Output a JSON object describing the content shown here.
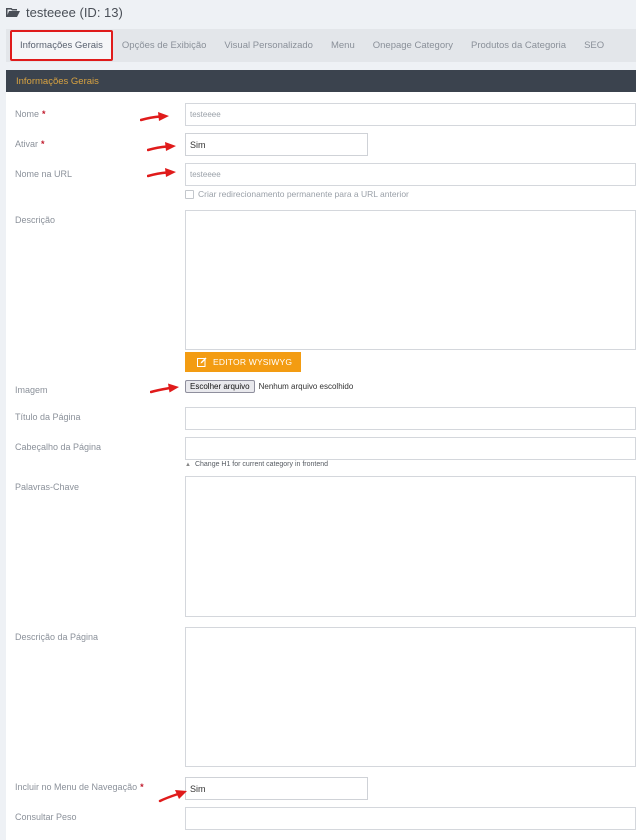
{
  "header": {
    "title": "testeeee (ID: 13)"
  },
  "tabs": [
    {
      "label": "Informações Gerais",
      "active": true
    },
    {
      "label": "Opções de Exibição"
    },
    {
      "label": "Visual Personalizado"
    },
    {
      "label": "Menu"
    },
    {
      "label": "Onepage Category"
    },
    {
      "label": "Produtos da Categoria"
    },
    {
      "label": "SEO"
    }
  ],
  "section": {
    "title": "Informações Gerais"
  },
  "form": {
    "nome": {
      "label": "Nome",
      "required": "*",
      "value": "testeeee"
    },
    "ativar": {
      "label": "Ativar",
      "required": "*",
      "value": "Sim"
    },
    "url": {
      "label": "Nome na URL",
      "value": "testeeee",
      "redirect_label": "Criar redirecionamento permanente para a URL anterior"
    },
    "descricao": {
      "label": "Descrição"
    },
    "wysiwyg": {
      "label": "EDITOR WYSIWYG"
    },
    "imagem": {
      "label": "Imagem",
      "button": "Escolher arquivo",
      "status": "Nenhum arquivo escolhido"
    },
    "titulo_pagina": {
      "label": "Título da Página"
    },
    "cabecalho_pagina": {
      "label": "Cabeçalho da Página",
      "hint": "Change H1 for current category in frontend"
    },
    "palavras_chave": {
      "label": "Palavras-Chave"
    },
    "descricao_pagina": {
      "label": "Descrição da Página"
    },
    "menu_navegacao": {
      "label": "Incluir no Menu de Navegação",
      "required": "*",
      "value": "Sim"
    },
    "consultar_peso": {
      "label": "Consultar Peso"
    }
  },
  "colors": {
    "accent": "#f39c12",
    "header_bg": "#3b434e",
    "section_title": "#d9a341",
    "required": "#c0192b",
    "annotation": "#e01b1b"
  },
  "icons": [
    "folder-open-icon",
    "edit-icon",
    "annotation-arrow"
  ]
}
